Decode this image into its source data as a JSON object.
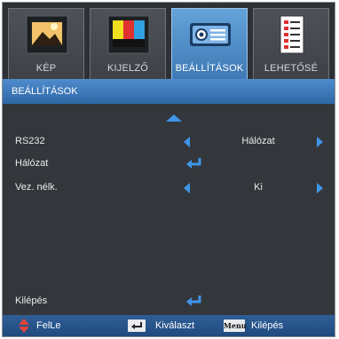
{
  "tabs": [
    {
      "label": "KÉP",
      "icon": "picture-icon",
      "active": false
    },
    {
      "label": "KIJELZŐ",
      "icon": "display-icon",
      "active": false
    },
    {
      "label": "BEÁLLÍTÁSOK",
      "icon": "projector-icon",
      "active": true
    },
    {
      "label": "LEHETŐSÉ",
      "icon": "options-list-icon",
      "active": false
    }
  ],
  "section_title": "BEÁLLÍTÁSOK",
  "rows": {
    "rs232": {
      "label": "RS232",
      "value": "Hálózat"
    },
    "network": {
      "label": "Hálózat"
    },
    "remote": {
      "label": "Vez. nélk.",
      "value": "Ki"
    },
    "exit": {
      "label": "Kilépés"
    }
  },
  "footer": {
    "updown_label": "FelLe",
    "select_label": "Kiválaszt",
    "menu_key": "Menu",
    "exit_label": "Kilépés"
  },
  "colors": {
    "accent": "#3f95e8",
    "active_tab": "#4f8ccd",
    "background": "#33373c",
    "footer": "#2f5f97",
    "updown_arrow": "#e0443a"
  }
}
